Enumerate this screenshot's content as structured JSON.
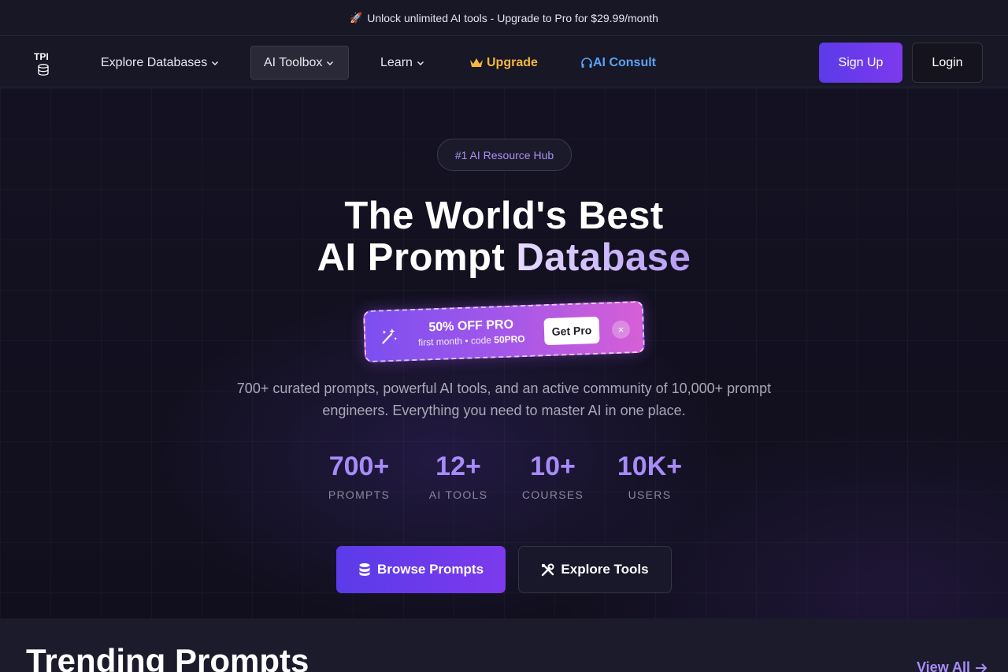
{
  "announcement": {
    "icon": "rocket-icon",
    "text": "Unlock unlimited AI tools - Upgrade to Pro for $29.99/month"
  },
  "nav": {
    "logo": "TPI",
    "items": [
      {
        "label": "Explore Databases",
        "dropdown": true
      },
      {
        "label": "AI Toolbox",
        "dropdown": true,
        "active": true
      },
      {
        "label": "Learn",
        "dropdown": true
      },
      {
        "label": "Upgrade",
        "icon": "crown-icon"
      },
      {
        "label": "AI Consult",
        "icon": "headset-icon"
      }
    ],
    "signup": "Sign Up",
    "login": "Login"
  },
  "hero": {
    "badge": "#1 AI Resource Hub",
    "headline_line1": "The World's Best",
    "headline_line2_plain": "AI Prompt",
    "headline_line2_accent": "Database",
    "promo": {
      "title": "50% OFF PRO",
      "sub_prefix": "first month • code",
      "code": "50PRO",
      "button": "Get Pro",
      "close": "×"
    },
    "description": "700+ curated prompts, powerful AI tools, and an active community of 10,000+ prompt engineers. Everything you need to master AI in one place.",
    "stats": [
      {
        "value": "700+",
        "label": "PROMPTS"
      },
      {
        "value": "12+",
        "label": "AI TOOLS"
      },
      {
        "value": "10+",
        "label": "COURSES"
      },
      {
        "value": "10K+",
        "label": "USERS"
      }
    ],
    "browse_button": "Browse Prompts",
    "explore_button": "Explore Tools"
  },
  "trending": {
    "title": "Trending Prompts",
    "view_all": "View All"
  },
  "colors": {
    "accent": "#7c3aed",
    "upgrade": "#f6b73c",
    "consult": "#5aa2f5",
    "stat": "#a78bfa"
  }
}
